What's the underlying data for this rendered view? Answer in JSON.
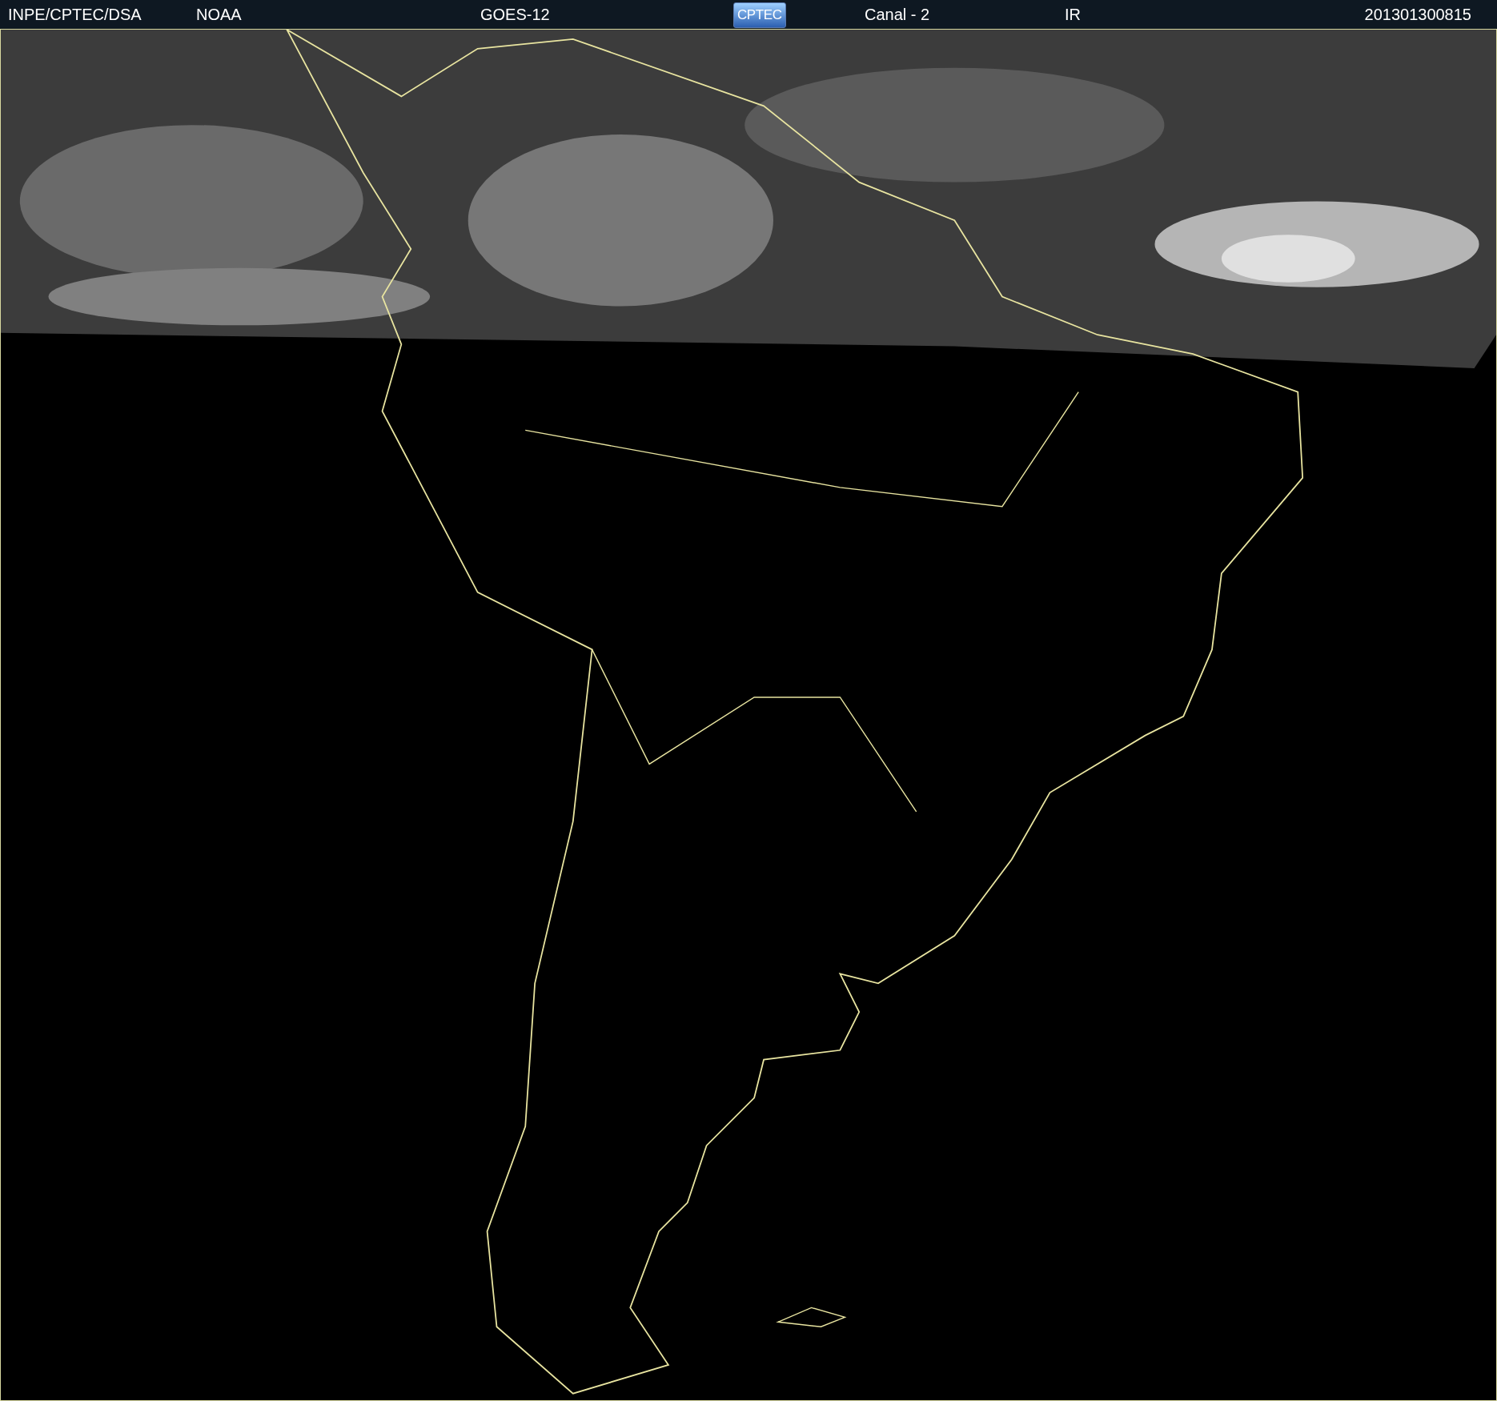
{
  "header": {
    "items": [
      {
        "kind": "text",
        "text": "INPE/CPTEC/DSA"
      },
      {
        "kind": "text",
        "text": "NOAA"
      },
      {
        "kind": "text",
        "text": "GOES-12"
      },
      {
        "kind": "logo",
        "text": "CPTEC"
      },
      {
        "kind": "text",
        "text": "Canal - 2"
      },
      {
        "kind": "text",
        "text": "IR"
      },
      {
        "kind": "text",
        "text": "201301300815"
      }
    ]
  }
}
